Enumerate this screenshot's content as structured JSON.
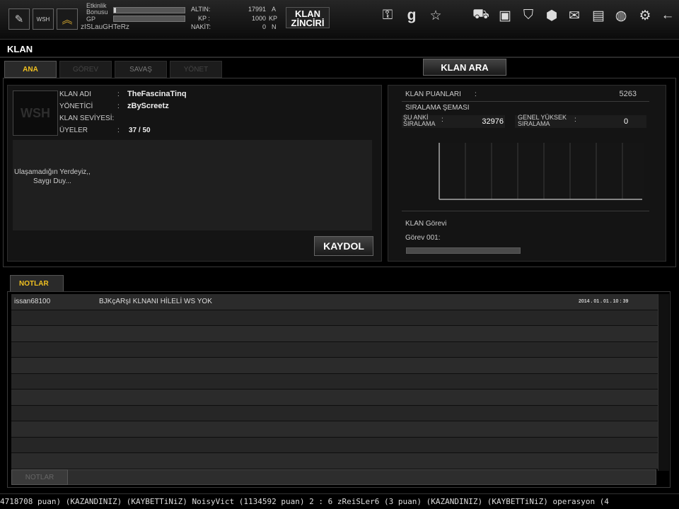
{
  "topbar": {
    "xp_label_1": "Etkinlik",
    "xp_label_2": "Bonusu",
    "gp_label": "GP",
    "username": "zISLauGHTeRz",
    "xp_progress": 0.03,
    "gp_progress": 0.0,
    "gold_label": "ALTIN:",
    "gold_value": "17991",
    "gold_unit": "A",
    "kp_label": "KP :",
    "kp_value": "1000",
    "kp_unit": "KP",
    "cash_label": "NAKİT:",
    "cash_value": "0",
    "cash_unit": "N",
    "zincir_line1": "KLAN",
    "zincir_line2": "ZİNCİRİ",
    "icons": [
      "notes-icon",
      "clan-emblem-icon",
      "rank-chevron-icon",
      "search-key-icon",
      "g-icon",
      "star-icon",
      "cart-icon",
      "inventory-icon",
      "shield-icon",
      "box-icon",
      "mail-icon",
      "profile-icon",
      "globe-icon",
      "gear-icon",
      "back-arrow-icon"
    ]
  },
  "page": {
    "title": "KLAN",
    "tabs": [
      {
        "label": "ANA"
      },
      {
        "label": "GÖREV"
      },
      {
        "label": "SAVAŞ"
      },
      {
        "label": "YÖNET"
      }
    ],
    "search_button": "KLAN ARA"
  },
  "clan": {
    "logo_text": "WSH",
    "name_label": "KLAN ADI",
    "name_sep": ":",
    "name_value": "TheFascinaTinq",
    "admin_label": "YÖNETİCİ",
    "admin_sep": ":",
    "admin_value": "zByScreetz",
    "level_label": "KLAN SEVİYESİ:",
    "members_label": "ÜYELER",
    "members_sep": ":",
    "members_value": "37 / 50",
    "description_line1": "Ulaşamadığın Yerdeyiz,,",
    "description_line2": "Saygı  Duy...",
    "register_button": "KAYDOL"
  },
  "points": {
    "points_label": "KLAN PUANLARI",
    "points_sep": ":",
    "points_value": "5263",
    "chart_title": "SIRALAMA ŞEMASI",
    "current_rank_label_1": "ŞU ANKİ",
    "current_rank_label_2": "SIRALAMA",
    "current_rank_value": "32976",
    "best_rank_label_1": "GENEL YÜKSEK",
    "best_rank_label_2": "SIRALAMA",
    "best_rank_value": "0",
    "mission_title": "KLAN Görevi",
    "mission_label": "Görev  001:",
    "mission_progress": 0.0
  },
  "notes": {
    "tab_label": "NOTLAR",
    "button_label": "NOTLAR",
    "rows": [
      {
        "author": "issan68100",
        "message": "BJKçARşI KLNANI HİLELİ WS YOK",
        "date": "2014 . 01 . 01 . 10 : 39"
      },
      {
        "author": "",
        "message": "",
        "date": ""
      },
      {
        "author": "",
        "message": "",
        "date": ""
      },
      {
        "author": "",
        "message": "",
        "date": ""
      },
      {
        "author": "",
        "message": "",
        "date": ""
      },
      {
        "author": "",
        "message": "",
        "date": ""
      },
      {
        "author": "",
        "message": "",
        "date": ""
      },
      {
        "author": "",
        "message": "",
        "date": ""
      },
      {
        "author": "",
        "message": "",
        "date": ""
      },
      {
        "author": "",
        "message": "",
        "date": ""
      },
      {
        "author": "",
        "message": "",
        "date": ""
      }
    ]
  },
  "ticker": {
    "text": "4718708 puan) (KAZANDINIZ)        (KAYBETTiNiZ) NoisyVict (1134592 puan) 2 : 6 zReiSLer6 (3 puan) (KAZANDINIZ)        (KAYBETTiNiZ) operasyon (4"
  }
}
